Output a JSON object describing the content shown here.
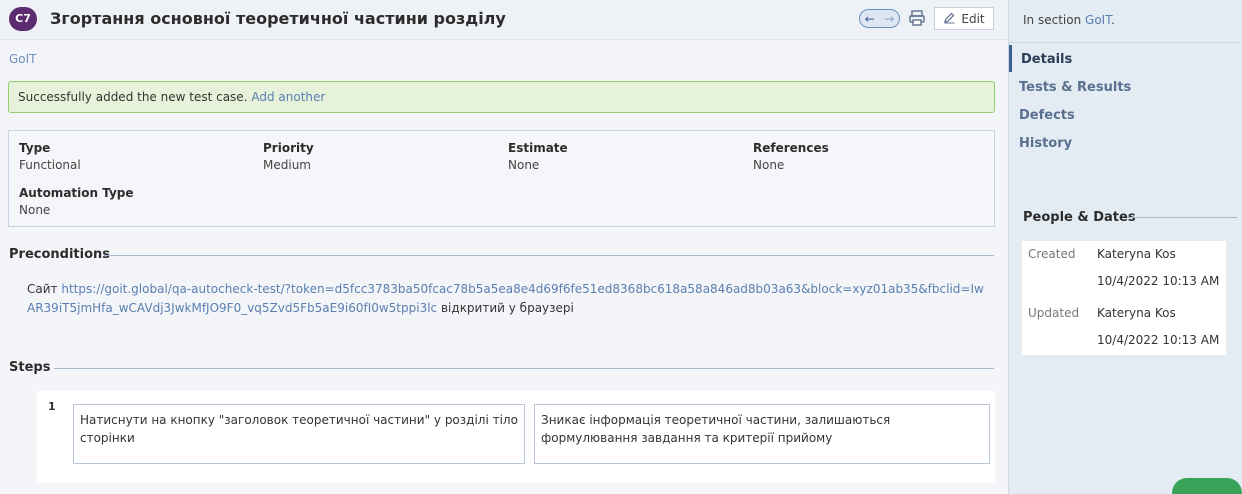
{
  "header": {
    "badge": "C7",
    "title": "Згортання основної теоретичної частини розділу",
    "prev_icon": "arrow-left-icon",
    "next_icon": "arrow-right-icon",
    "print_icon": "printer-icon",
    "edit_label": "Edit"
  },
  "breadcrumb": "GoIT",
  "alert": {
    "message": "Successfully added the new test case.",
    "link": "Add another",
    "color": "#e6f2d9"
  },
  "properties": [
    {
      "key": "Type",
      "value": "Functional"
    },
    {
      "key": "Priority",
      "value": "Medium"
    },
    {
      "key": "Estimate",
      "value": "None"
    },
    {
      "key": "References",
      "value": "None"
    },
    {
      "key": "Automation Type",
      "value": "None"
    }
  ],
  "preconditions": {
    "heading": "Preconditions",
    "prefix": "Сайт",
    "url": "https://goit.global/qa-autocheck-test/?token=d5fcc3783ba50fcac78b5a5ea8e4d69f6fe51ed8368bc618a58a846ad8b03a63&block=xyz01ab35&fbclid=IwAR39iT5jmHfa_wCAVdj3JwkMfJO9F0_vq5Zvd5Fb5aE9i60fI0w5tppi3lc",
    "suffix": "відкритий у браузері"
  },
  "steps": {
    "heading": "Steps",
    "items": [
      {
        "number": "1",
        "action": "Натиснути на кнопку \"заголовок теоретичної частини\" у розділі тіло сторінки",
        "expected": "Зникає інформація теоретичної частини, залишаються формулювання завдання та критерії прийому"
      }
    ]
  },
  "sidebar": {
    "in_section_label": "In section",
    "in_section_link": "GoIT",
    "in_section_dot": ".",
    "nav": [
      "Details",
      "Tests & Results",
      "Defects",
      "History"
    ],
    "people_heading": "People & Dates",
    "created_label": "Created",
    "created_by": "Kateryna Kos",
    "created_at": "10/4/2022 10:13 AM",
    "updated_label": "Updated",
    "updated_by": "Kateryna Kos",
    "updated_at": "10/4/2022 10:13 AM"
  },
  "colors": {
    "badge": "#5b2c6f",
    "link": "#5a7fb0",
    "sidebar": "#e3ebf3"
  }
}
